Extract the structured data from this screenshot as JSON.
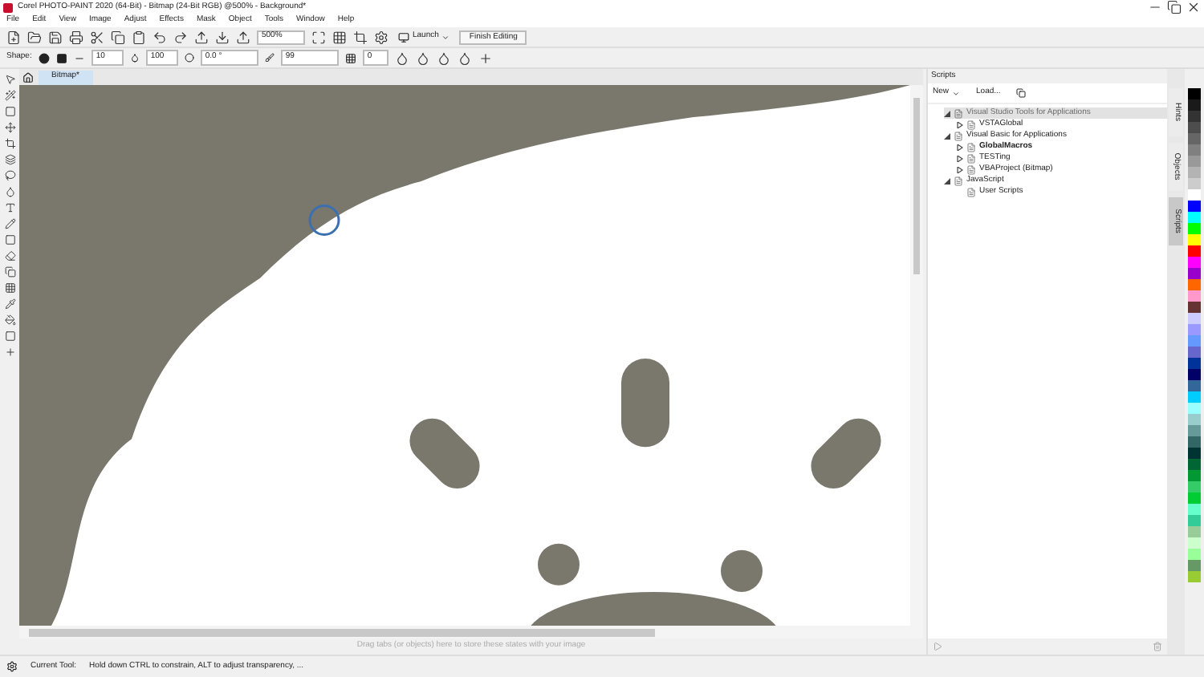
{
  "window": {
    "title": "Corel PHOTO-PAINT 2020 (64-Bit) - Bitmap (24-Bit RGB) @500% - Background*"
  },
  "menu": [
    "File",
    "Edit",
    "View",
    "Image",
    "Adjust",
    "Effects",
    "Mask",
    "Object",
    "Tools",
    "Window",
    "Help"
  ],
  "toolbar": {
    "zoom": "500%",
    "launch": "Launch",
    "finish": "Finish Editing"
  },
  "property_bar": {
    "shape_label": "Shape:",
    "size": "10",
    "transparency": "100",
    "rotate": "0.0 °",
    "flatten": "99",
    "soft": "0"
  },
  "document_tab": {
    "label": "Bitmap*",
    "selected": true
  },
  "scripts_docker": {
    "title": "Scripts",
    "new": "New",
    "load": "Load...",
    "tree": [
      {
        "label": "Visual Studio Tools for Applications",
        "selected": true,
        "expanded": true,
        "disabled": true,
        "children": [
          {
            "label": "VSTAGlobal",
            "selected": false,
            "expanded": false
          }
        ]
      },
      {
        "label": "Visual Basic for Applications",
        "selected": false,
        "expanded": true,
        "children": [
          {
            "label": "GlobalMacros",
            "bold": true,
            "selected": false,
            "expanded": false
          },
          {
            "label": "TESTing",
            "selected": false,
            "expanded": false
          },
          {
            "label": "VBAProject (Bitmap)",
            "selected": false,
            "expanded": false
          }
        ]
      },
      {
        "label": "JavaScript",
        "selected": false,
        "expanded": true,
        "children": [
          {
            "label": "User Scripts",
            "selected": false
          }
        ]
      }
    ]
  },
  "side_tabs": [
    {
      "label": "Hints",
      "selected": false
    },
    {
      "label": "Objects",
      "selected": false
    },
    {
      "label": "Scripts",
      "selected": true
    }
  ],
  "drag_hint": "Drag tabs (or objects) here to store these states with your image",
  "palette": [
    {
      "color": "#000000"
    },
    {
      "color": "#1a1a1a"
    },
    {
      "color": "#333333"
    },
    {
      "color": "#4d4d4d"
    },
    {
      "color": "#666666"
    },
    {
      "color": "#808080"
    },
    {
      "color": "#999999"
    },
    {
      "color": "#b3b3b3"
    },
    {
      "color": "#cccccc"
    },
    {
      "color": "#ffffff"
    },
    {
      "color": "#0000ff"
    },
    {
      "color": "#00ffff"
    },
    {
      "color": "#00ff00"
    },
    {
      "color": "#ffff00"
    },
    {
      "color": "#ff0000"
    },
    {
      "color": "#ff00ff"
    },
    {
      "color": "#9900cc"
    },
    {
      "color": "#ff6600"
    },
    {
      "color": "#ff99cc"
    },
    {
      "color": "#663333"
    },
    {
      "color": "#ccccff"
    },
    {
      "color": "#9999ff"
    },
    {
      "color": "#6699ff"
    },
    {
      "color": "#6666cc"
    },
    {
      "color": "#003399"
    },
    {
      "color": "#000066"
    },
    {
      "color": "#336699"
    },
    {
      "color": "#00ccff"
    },
    {
      "color": "#99ffff"
    },
    {
      "color": "#99cccc"
    },
    {
      "color": "#669999"
    },
    {
      "color": "#336666"
    },
    {
      "color": "#003333"
    },
    {
      "color": "#006633"
    },
    {
      "color": "#009933"
    },
    {
      "color": "#33cc66"
    },
    {
      "color": "#00cc33"
    },
    {
      "color": "#66ffcc"
    },
    {
      "color": "#33cc99"
    },
    {
      "color": "#99cc99"
    },
    {
      "color": "#ccffcc"
    },
    {
      "color": "#99ff99"
    },
    {
      "color": "#669966"
    },
    {
      "color": "#99cc33"
    }
  ],
  "status_bar": {
    "label": "Current Tool:",
    "hint": "Hold down CTRL to constrain, ALT to adjust transparency, ..."
  }
}
